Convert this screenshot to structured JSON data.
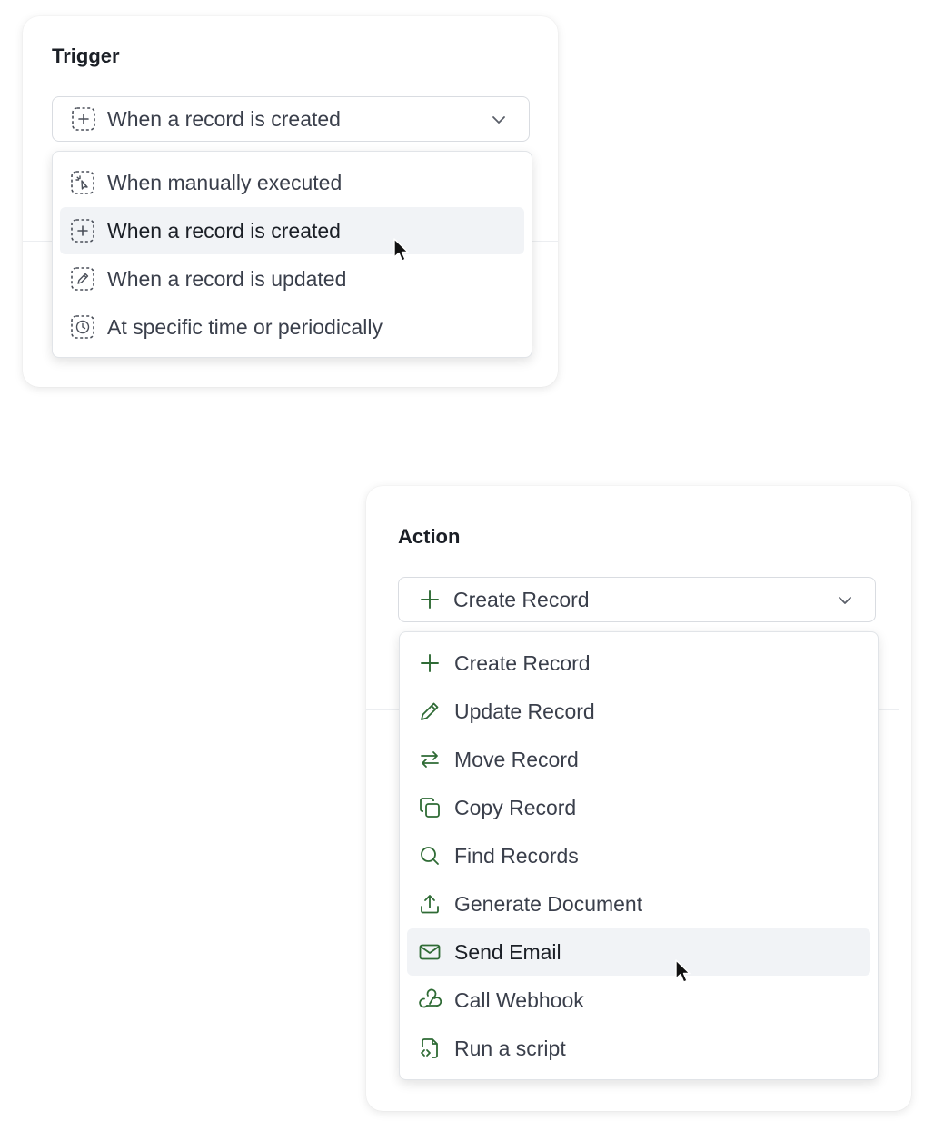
{
  "trigger": {
    "title": "Trigger",
    "selected_label": "When a record is created",
    "selected_icon": "dashed-plus-icon",
    "options": [
      {
        "label": "When manually executed",
        "icon": "dashed-click-icon",
        "active": false
      },
      {
        "label": "When a record is created",
        "icon": "dashed-plus-icon",
        "active": true
      },
      {
        "label": "When a record is updated",
        "icon": "dashed-pencil-icon",
        "active": false
      },
      {
        "label": "At specific time or periodically",
        "icon": "dashed-clock-icon",
        "active": false
      }
    ]
  },
  "action": {
    "title": "Action",
    "selected_label": "Create Record",
    "selected_icon": "plus-icon",
    "options": [
      {
        "label": "Create Record",
        "icon": "plus-icon",
        "active": false
      },
      {
        "label": "Update Record",
        "icon": "pencil-icon",
        "active": false
      },
      {
        "label": "Move Record",
        "icon": "swap-arrows-icon",
        "active": false
      },
      {
        "label": "Copy Record",
        "icon": "copy-icon",
        "active": false
      },
      {
        "label": "Find Records",
        "icon": "search-icon",
        "active": false
      },
      {
        "label": "Generate Document",
        "icon": "upload-icon",
        "active": false
      },
      {
        "label": "Send Email",
        "icon": "mail-icon",
        "active": true
      },
      {
        "label": "Call Webhook",
        "icon": "webhook-icon",
        "active": false
      },
      {
        "label": "Run a script",
        "icon": "script-file-icon",
        "active": false
      }
    ]
  },
  "colors": {
    "action_icon": "#2f6b35",
    "trigger_icon": "#4a4f59",
    "active_row": "#f1f3f6",
    "border": "#d9dce1"
  }
}
